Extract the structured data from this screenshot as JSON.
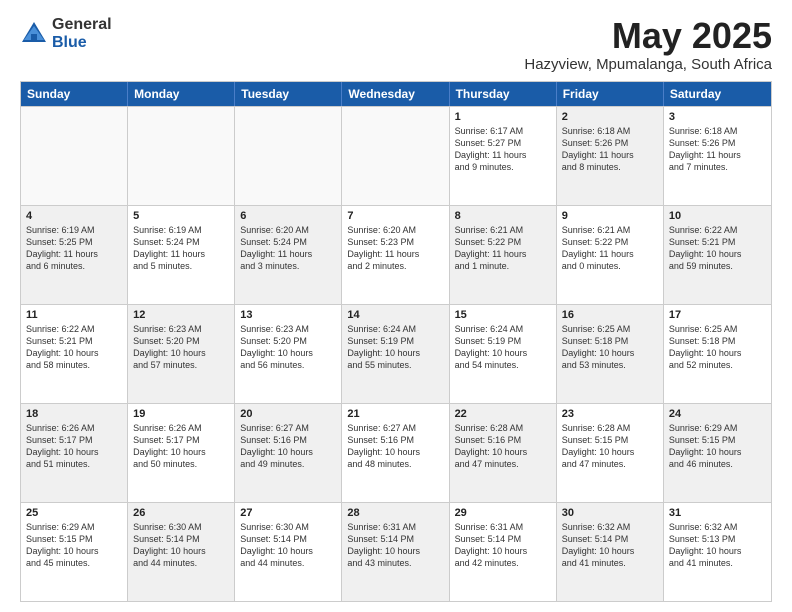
{
  "logo": {
    "general": "General",
    "blue": "Blue"
  },
  "title": "May 2025",
  "subtitle": "Hazyview, Mpumalanga, South Africa",
  "header_days": [
    "Sunday",
    "Monday",
    "Tuesday",
    "Wednesday",
    "Thursday",
    "Friday",
    "Saturday"
  ],
  "weeks": [
    [
      {
        "day": "",
        "info": "",
        "shaded": false,
        "empty": true
      },
      {
        "day": "",
        "info": "",
        "shaded": false,
        "empty": true
      },
      {
        "day": "",
        "info": "",
        "shaded": false,
        "empty": true
      },
      {
        "day": "",
        "info": "",
        "shaded": false,
        "empty": true
      },
      {
        "day": "1",
        "info": "Sunrise: 6:17 AM\nSunset: 5:27 PM\nDaylight: 11 hours\nand 9 minutes.",
        "shaded": false,
        "empty": false
      },
      {
        "day": "2",
        "info": "Sunrise: 6:18 AM\nSunset: 5:26 PM\nDaylight: 11 hours\nand 8 minutes.",
        "shaded": true,
        "empty": false
      },
      {
        "day": "3",
        "info": "Sunrise: 6:18 AM\nSunset: 5:26 PM\nDaylight: 11 hours\nand 7 minutes.",
        "shaded": false,
        "empty": false
      }
    ],
    [
      {
        "day": "4",
        "info": "Sunrise: 6:19 AM\nSunset: 5:25 PM\nDaylight: 11 hours\nand 6 minutes.",
        "shaded": true,
        "empty": false
      },
      {
        "day": "5",
        "info": "Sunrise: 6:19 AM\nSunset: 5:24 PM\nDaylight: 11 hours\nand 5 minutes.",
        "shaded": false,
        "empty": false
      },
      {
        "day": "6",
        "info": "Sunrise: 6:20 AM\nSunset: 5:24 PM\nDaylight: 11 hours\nand 3 minutes.",
        "shaded": true,
        "empty": false
      },
      {
        "day": "7",
        "info": "Sunrise: 6:20 AM\nSunset: 5:23 PM\nDaylight: 11 hours\nand 2 minutes.",
        "shaded": false,
        "empty": false
      },
      {
        "day": "8",
        "info": "Sunrise: 6:21 AM\nSunset: 5:22 PM\nDaylight: 11 hours\nand 1 minute.",
        "shaded": true,
        "empty": false
      },
      {
        "day": "9",
        "info": "Sunrise: 6:21 AM\nSunset: 5:22 PM\nDaylight: 11 hours\nand 0 minutes.",
        "shaded": false,
        "empty": false
      },
      {
        "day": "10",
        "info": "Sunrise: 6:22 AM\nSunset: 5:21 PM\nDaylight: 10 hours\nand 59 minutes.",
        "shaded": true,
        "empty": false
      }
    ],
    [
      {
        "day": "11",
        "info": "Sunrise: 6:22 AM\nSunset: 5:21 PM\nDaylight: 10 hours\nand 58 minutes.",
        "shaded": false,
        "empty": false
      },
      {
        "day": "12",
        "info": "Sunrise: 6:23 AM\nSunset: 5:20 PM\nDaylight: 10 hours\nand 57 minutes.",
        "shaded": true,
        "empty": false
      },
      {
        "day": "13",
        "info": "Sunrise: 6:23 AM\nSunset: 5:20 PM\nDaylight: 10 hours\nand 56 minutes.",
        "shaded": false,
        "empty": false
      },
      {
        "day": "14",
        "info": "Sunrise: 6:24 AM\nSunset: 5:19 PM\nDaylight: 10 hours\nand 55 minutes.",
        "shaded": true,
        "empty": false
      },
      {
        "day": "15",
        "info": "Sunrise: 6:24 AM\nSunset: 5:19 PM\nDaylight: 10 hours\nand 54 minutes.",
        "shaded": false,
        "empty": false
      },
      {
        "day": "16",
        "info": "Sunrise: 6:25 AM\nSunset: 5:18 PM\nDaylight: 10 hours\nand 53 minutes.",
        "shaded": true,
        "empty": false
      },
      {
        "day": "17",
        "info": "Sunrise: 6:25 AM\nSunset: 5:18 PM\nDaylight: 10 hours\nand 52 minutes.",
        "shaded": false,
        "empty": false
      }
    ],
    [
      {
        "day": "18",
        "info": "Sunrise: 6:26 AM\nSunset: 5:17 PM\nDaylight: 10 hours\nand 51 minutes.",
        "shaded": true,
        "empty": false
      },
      {
        "day": "19",
        "info": "Sunrise: 6:26 AM\nSunset: 5:17 PM\nDaylight: 10 hours\nand 50 minutes.",
        "shaded": false,
        "empty": false
      },
      {
        "day": "20",
        "info": "Sunrise: 6:27 AM\nSunset: 5:16 PM\nDaylight: 10 hours\nand 49 minutes.",
        "shaded": true,
        "empty": false
      },
      {
        "day": "21",
        "info": "Sunrise: 6:27 AM\nSunset: 5:16 PM\nDaylight: 10 hours\nand 48 minutes.",
        "shaded": false,
        "empty": false
      },
      {
        "day": "22",
        "info": "Sunrise: 6:28 AM\nSunset: 5:16 PM\nDaylight: 10 hours\nand 47 minutes.",
        "shaded": true,
        "empty": false
      },
      {
        "day": "23",
        "info": "Sunrise: 6:28 AM\nSunset: 5:15 PM\nDaylight: 10 hours\nand 47 minutes.",
        "shaded": false,
        "empty": false
      },
      {
        "day": "24",
        "info": "Sunrise: 6:29 AM\nSunset: 5:15 PM\nDaylight: 10 hours\nand 46 minutes.",
        "shaded": true,
        "empty": false
      }
    ],
    [
      {
        "day": "25",
        "info": "Sunrise: 6:29 AM\nSunset: 5:15 PM\nDaylight: 10 hours\nand 45 minutes.",
        "shaded": false,
        "empty": false
      },
      {
        "day": "26",
        "info": "Sunrise: 6:30 AM\nSunset: 5:14 PM\nDaylight: 10 hours\nand 44 minutes.",
        "shaded": true,
        "empty": false
      },
      {
        "day": "27",
        "info": "Sunrise: 6:30 AM\nSunset: 5:14 PM\nDaylight: 10 hours\nand 44 minutes.",
        "shaded": false,
        "empty": false
      },
      {
        "day": "28",
        "info": "Sunrise: 6:31 AM\nSunset: 5:14 PM\nDaylight: 10 hours\nand 43 minutes.",
        "shaded": true,
        "empty": false
      },
      {
        "day": "29",
        "info": "Sunrise: 6:31 AM\nSunset: 5:14 PM\nDaylight: 10 hours\nand 42 minutes.",
        "shaded": false,
        "empty": false
      },
      {
        "day": "30",
        "info": "Sunrise: 6:32 AM\nSunset: 5:14 PM\nDaylight: 10 hours\nand 41 minutes.",
        "shaded": true,
        "empty": false
      },
      {
        "day": "31",
        "info": "Sunrise: 6:32 AM\nSunset: 5:13 PM\nDaylight: 10 hours\nand 41 minutes.",
        "shaded": false,
        "empty": false
      }
    ]
  ]
}
